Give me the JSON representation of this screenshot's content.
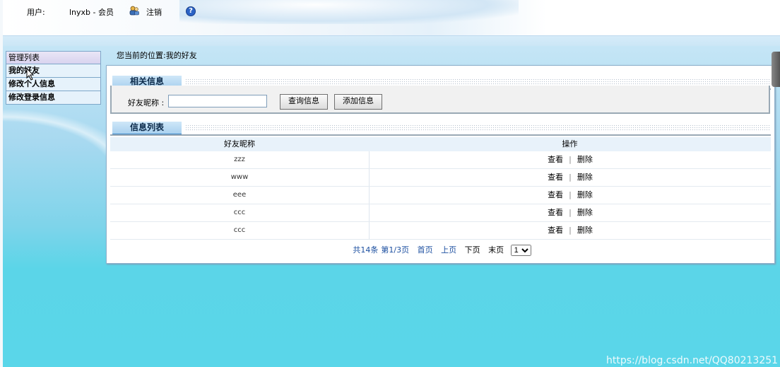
{
  "header": {
    "user_label": "用户:",
    "user_name": "lnyxb - 会员",
    "logout_label": "注销",
    "help_icon": "?"
  },
  "menu": {
    "title": "管理列表",
    "items": [
      {
        "label": "我的好友"
      },
      {
        "label": "修改个人信息"
      },
      {
        "label": "修改登录信息"
      }
    ]
  },
  "breadcrumb": {
    "prefix": "您当前的位置:",
    "current": "我的好友"
  },
  "search_section": {
    "title": "相关信息",
    "field_label": "好友昵称 :",
    "field_value": "",
    "query_button": "查询信息",
    "add_button": "添加信息"
  },
  "list_section": {
    "title": "信息列表",
    "columns": [
      "好友昵称",
      "操作"
    ],
    "rows": [
      {
        "name": "zzz",
        "view": "查看",
        "sep": "|",
        "delete": "删除"
      },
      {
        "name": "www",
        "view": "查看",
        "sep": "|",
        "delete": "删除"
      },
      {
        "name": "eee",
        "view": "查看",
        "sep": "|",
        "delete": "删除"
      },
      {
        "name": "ccc",
        "view": "查看",
        "sep": "|",
        "delete": "删除"
      },
      {
        "name": "ccc",
        "view": "查看",
        "sep": "|",
        "delete": "删除"
      }
    ]
  },
  "pager": {
    "total": "共14条",
    "page_info": "第1/3页",
    "first": "首页",
    "prev": "上页",
    "next": "下页",
    "last": "末页",
    "selected_page": "1"
  },
  "watermark": "https://blog.csdn.net/QQ80213251",
  "colors": {
    "link": "#1c4fa0",
    "section_tab": "#a9d1ef",
    "background_bottom": "#5ad6e9"
  }
}
